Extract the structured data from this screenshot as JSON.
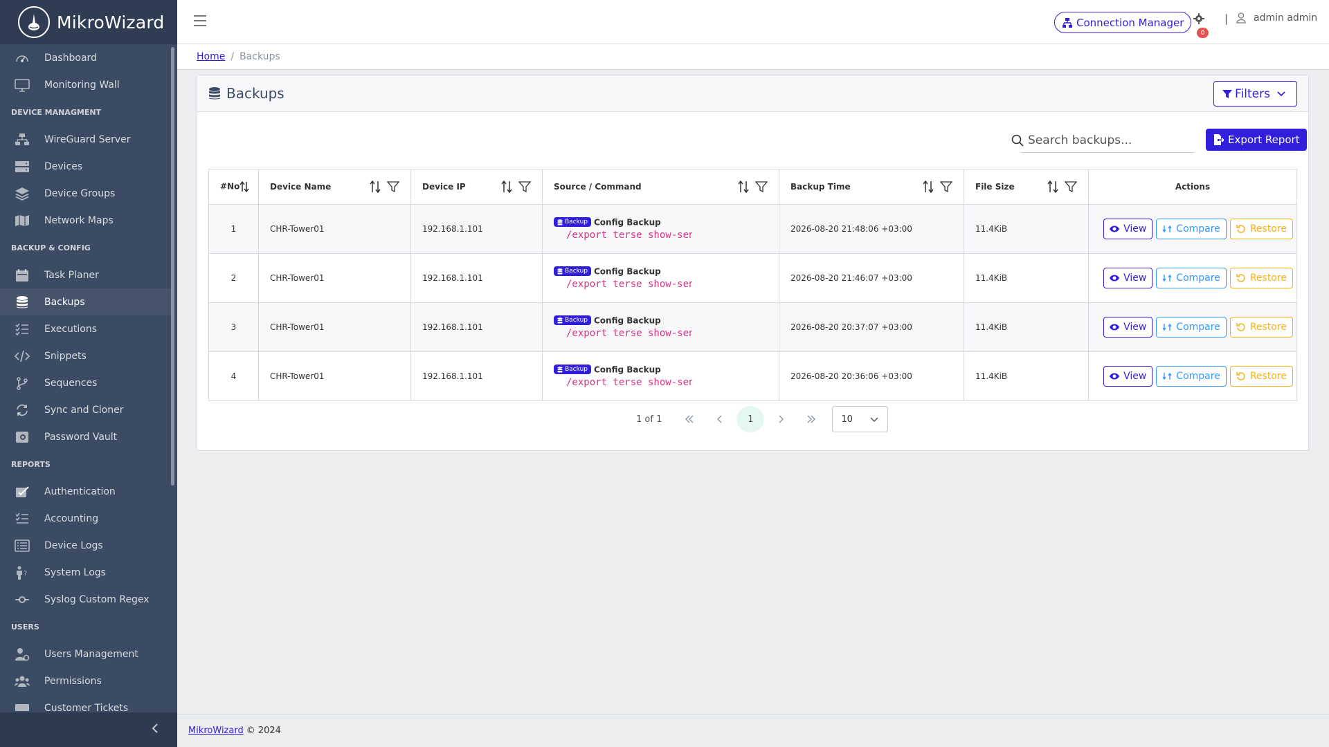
{
  "brand": {
    "name": "MikroWizard"
  },
  "sidebar": {
    "top_items": [
      {
        "label": "Dashboard",
        "icon": "speedometer-icon"
      },
      {
        "label": "Monitoring Wall",
        "icon": "monitor-icon"
      }
    ],
    "sections": [
      {
        "title": "DEVICE MANAGMENT",
        "items": [
          {
            "label": "WireGuard Server",
            "icon": "network-icon"
          },
          {
            "label": "Devices",
            "icon": "storage-icon"
          },
          {
            "label": "Device Groups",
            "icon": "layers-icon"
          },
          {
            "label": "Network Maps",
            "icon": "map-icon"
          }
        ]
      },
      {
        "title": "BACKUP & CONFIG",
        "items": [
          {
            "label": "Task Planer",
            "icon": "calendar-icon"
          },
          {
            "label": "Backups",
            "icon": "database-icon",
            "active": true
          },
          {
            "label": "Executions",
            "icon": "list-check-icon"
          },
          {
            "label": "Snippets",
            "icon": "code-icon"
          },
          {
            "label": "Sequences",
            "icon": "branch-icon"
          },
          {
            "label": "Sync and Cloner",
            "icon": "sync-icon"
          },
          {
            "label": "Password Vault",
            "icon": "vault-icon"
          }
        ]
      },
      {
        "title": "REPORTS",
        "items": [
          {
            "label": "Authentication",
            "icon": "check-square-icon"
          },
          {
            "label": "Accounting",
            "icon": "list-icon"
          },
          {
            "label": "Device Logs",
            "icon": "log-list-icon"
          },
          {
            "label": "System Logs",
            "icon": "person-question-icon"
          },
          {
            "label": "Syslog Custom Regex",
            "icon": "commit-icon"
          }
        ]
      },
      {
        "title": "USERS",
        "items": [
          {
            "label": "Users Management",
            "icon": "user-gear-icon"
          },
          {
            "label": "Permissions",
            "icon": "users-icon"
          },
          {
            "label": "Customer Tickets",
            "icon": "ticket-icon"
          }
        ]
      }
    ]
  },
  "header": {
    "connection_manager": "Connection Manager",
    "notification_count": "0",
    "separator": "|",
    "user_name": "admin admin"
  },
  "breadcrumb": {
    "home": "Home",
    "separator": "/",
    "current": "Backups"
  },
  "card": {
    "title": "Backups",
    "filters_label": "Filters",
    "search_placeholder": "Search backups...",
    "export_label": "Export Report"
  },
  "table": {
    "columns": {
      "no": "#No",
      "device_name": "Device Name",
      "device_ip": "Device IP",
      "source": "Source / Command",
      "backup_time": "Backup Time",
      "file_size": "File Size",
      "actions": "Actions"
    },
    "badge_label": "Backup",
    "rows": [
      {
        "no": "1",
        "device_name": "CHR-Tower01",
        "device_ip": "192.168.1.101",
        "source_title": "Config Backup",
        "command": "/export terse show-sens…",
        "backup_time": "2026-08-20 21:48:06 +03:00",
        "file_size": "11.4KiB"
      },
      {
        "no": "2",
        "device_name": "CHR-Tower01",
        "device_ip": "192.168.1.101",
        "source_title": "Config Backup",
        "command": "/export terse show-sens…",
        "backup_time": "2026-08-20 21:46:07 +03:00",
        "file_size": "11.4KiB"
      },
      {
        "no": "3",
        "device_name": "CHR-Tower01",
        "device_ip": "192.168.1.101",
        "source_title": "Config Backup",
        "command": "/export terse show-sens…",
        "backup_time": "2026-08-20 20:37:07 +03:00",
        "file_size": "11.4KiB"
      },
      {
        "no": "4",
        "device_name": "CHR-Tower01",
        "device_ip": "192.168.1.101",
        "source_title": "Config Backup",
        "command": "/export terse show-sens…",
        "backup_time": "2026-08-20 20:36:06 +03:00",
        "file_size": "11.4KiB"
      }
    ],
    "action_labels": {
      "view": "View",
      "compare": "Compare",
      "restore": "Restore"
    }
  },
  "pagination": {
    "info": "1 of 1",
    "current_page": "1",
    "page_size": "10"
  },
  "footer": {
    "brand_link": "MikroWizard",
    "copyright": "© 2024"
  },
  "colors": {
    "primary": "#321fdb",
    "info": "#3399ff",
    "warning": "#f9b115",
    "sidebar_bg": "#3c4b64",
    "command": "#d63384"
  }
}
